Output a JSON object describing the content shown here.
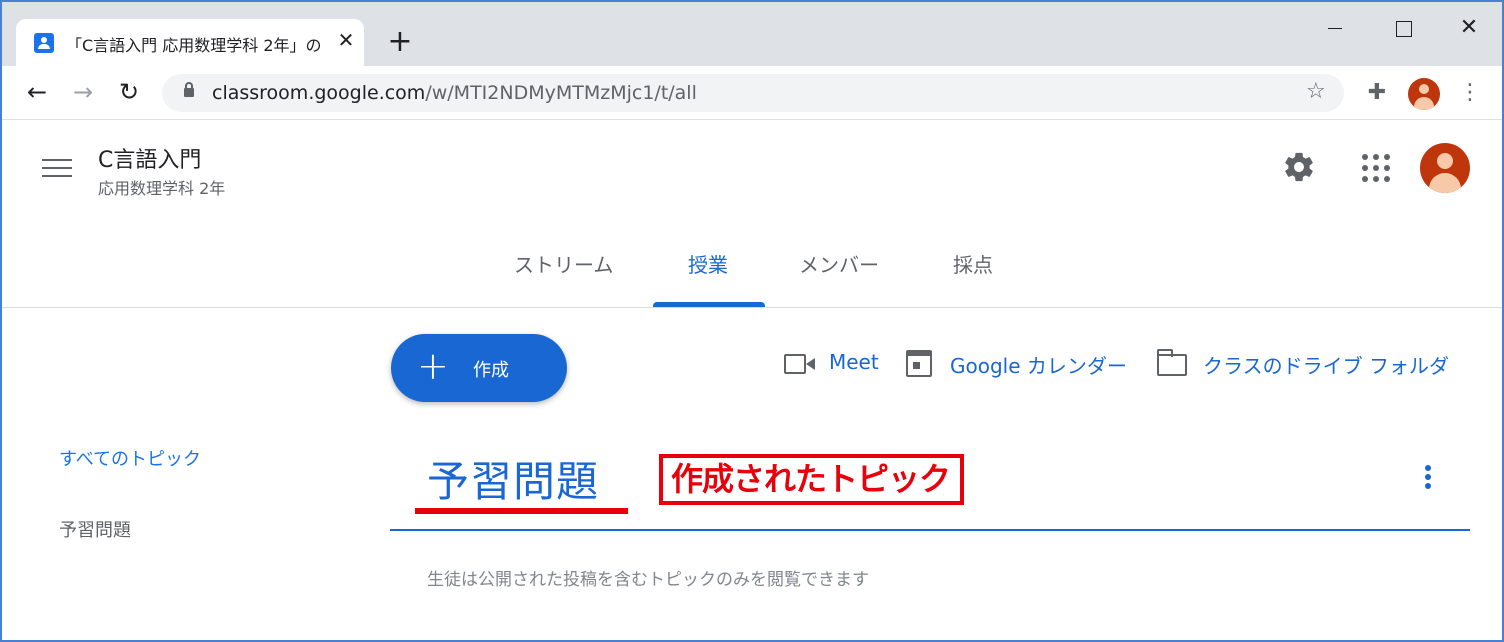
{
  "browser": {
    "tab_title": "「C言語入門 応用数理学科 2年」の",
    "tab_close": "✕",
    "new_tab": "+",
    "url_host": "classroom.google.com",
    "url_path": "/w/MTI2NDMyMTMzMjc1/t/all"
  },
  "header": {
    "class_name": "C言語入門",
    "section": "応用数理学科 2年"
  },
  "tabs": [
    {
      "label": "ストリーム"
    },
    {
      "label": "授業"
    },
    {
      "label": "メンバー"
    },
    {
      "label": "採点"
    }
  ],
  "active_tab": "授業",
  "create_button": {
    "icon": "+",
    "label": "作成"
  },
  "links": {
    "meet": "Meet",
    "calendar": "Google カレンダー",
    "drive": "クラスのドライブ フォルダ"
  },
  "sidebar": {
    "all_topics": "すべてのトピック",
    "topics": [
      "予習問題"
    ]
  },
  "topic": {
    "title": "予習問題",
    "note": "生徒は公開された投稿を含むトピックのみを閲覧できます"
  },
  "annotation": {
    "text": "作成されたトピック",
    "color": "#e8000b"
  },
  "colors": {
    "accent": "#1967d2",
    "frame": "#4a7fd6"
  }
}
